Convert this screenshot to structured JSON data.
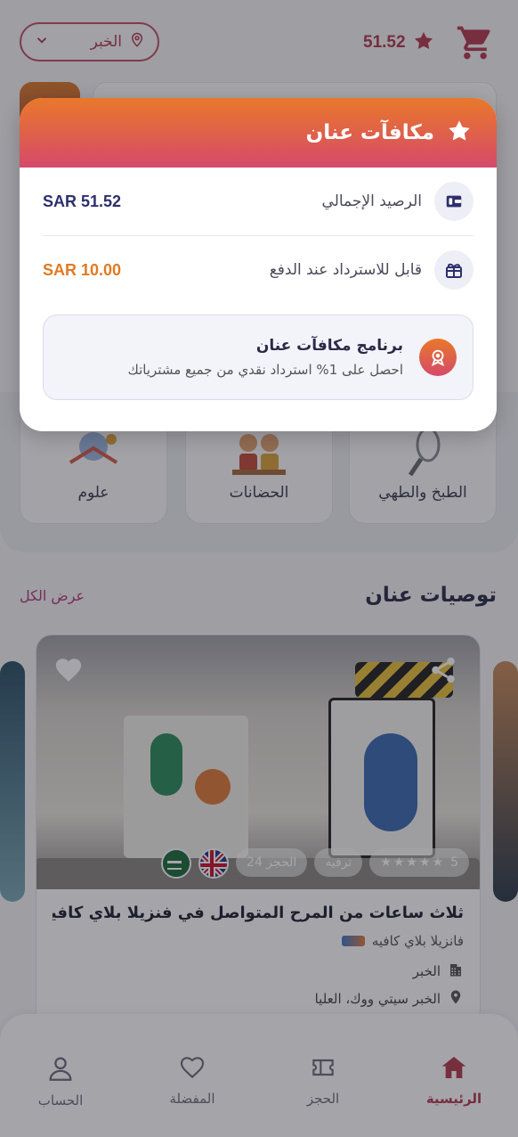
{
  "header": {
    "points_value": "51.52",
    "location_city": "الخبر"
  },
  "categories": [
    {
      "label": "علوم"
    },
    {
      "label": "الحضانات"
    },
    {
      "label": "الطبخ والطهي"
    }
  ],
  "recommendations": {
    "title": "توصيات عنان",
    "view_all": "عرض الكل",
    "card": {
      "rating": "5",
      "category_chip": "ترفيه",
      "booking_chip": "الحجز 24",
      "title": "ثلاث ساعات من المرح المتواصل في فنزيلا بلاي كافيه (ا...",
      "vendor": "فانزيلا بلاي كافيه",
      "city": "الخبر",
      "address": "الخبر سيتي ووك، العليا"
    }
  },
  "modal": {
    "title": "مكافآت عنان",
    "total_balance_label": "الرصيد الإجمالي",
    "total_balance_value": "SAR 51.52",
    "refundable_label": "قابل للاسترداد عند الدفع",
    "refundable_value": "SAR 10.00",
    "program_title": "برنامج مكافآت عنان",
    "program_desc": "احصل على 1% استرداد نقدي من جميع مشترياتك",
    "colors": {
      "balance": "#2d2f6e",
      "refundable": "#e07a22"
    }
  },
  "bottom_nav": [
    {
      "label": "الرئيسية",
      "icon": "home-icon"
    },
    {
      "label": "الحجز",
      "icon": "ticket-icon"
    },
    {
      "label": "المفضلة",
      "icon": "heart-icon"
    },
    {
      "label": "الحساب",
      "icon": "user-icon"
    }
  ]
}
